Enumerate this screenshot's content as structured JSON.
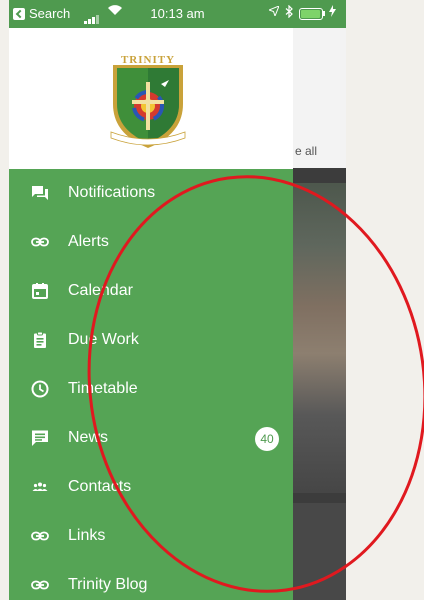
{
  "status_bar": {
    "back_label": "Search",
    "time": "10:13 am"
  },
  "background_app": {
    "see_all_label": "e all"
  },
  "drawer": {
    "logo": {
      "name": "TRINITY",
      "motto": "Excellence and Service for Christ"
    },
    "items": [
      {
        "label": "Notifications",
        "icon": "chat-icon"
      },
      {
        "label": "Alerts",
        "icon": "link-icon"
      },
      {
        "label": "Calendar",
        "icon": "calendar-icon"
      },
      {
        "label": "Due Work",
        "icon": "clipboard-icon"
      },
      {
        "label": "Timetable",
        "icon": "clock-icon"
      },
      {
        "label": "News",
        "icon": "message-icon",
        "badge": "40"
      },
      {
        "label": "Contacts",
        "icon": "people-icon"
      },
      {
        "label": "Links",
        "icon": "link-icon"
      },
      {
        "label": "Trinity Blog",
        "icon": "link-icon"
      }
    ]
  },
  "colors": {
    "drawer_green": "#55a455",
    "status_bar_green": "#4f9a4f",
    "annotation_red": "#e0191f"
  }
}
